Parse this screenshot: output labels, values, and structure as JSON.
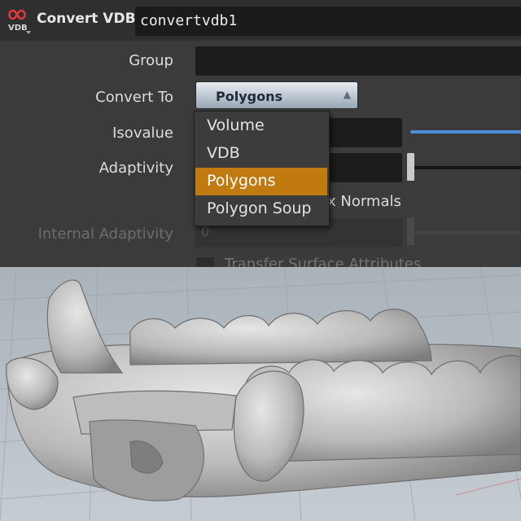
{
  "header": {
    "node_type_label": "Convert VDB",
    "node_name": "convertvdb1",
    "logo": {
      "icon": "vdb-node-icon",
      "text": "VDB"
    }
  },
  "parameters": {
    "group": {
      "label": "Group",
      "value": ""
    },
    "convert_to": {
      "label": "Convert To",
      "value": "Polygons"
    },
    "isovalue": {
      "label": "Isovalue"
    },
    "adaptivity": {
      "label": "Adaptivity"
    },
    "fix_normals": {
      "label_visible": "x Normals"
    },
    "internal_adaptivity": {
      "label": "Internal Adaptivity",
      "value": "0"
    },
    "transfer_surface_attributes": {
      "label": "Transfer Surface Attributes"
    }
  },
  "dropdown": {
    "options": [
      "Volume",
      "VDB",
      "Polygons",
      "Polygon Soup"
    ],
    "selected": "Polygons"
  },
  "colors": {
    "accent_selected": "#c07a10",
    "slider_blue": "#4a8fd8",
    "panel_bg": "#3b3b3b",
    "viewport_bg": "#b8bfc6"
  }
}
